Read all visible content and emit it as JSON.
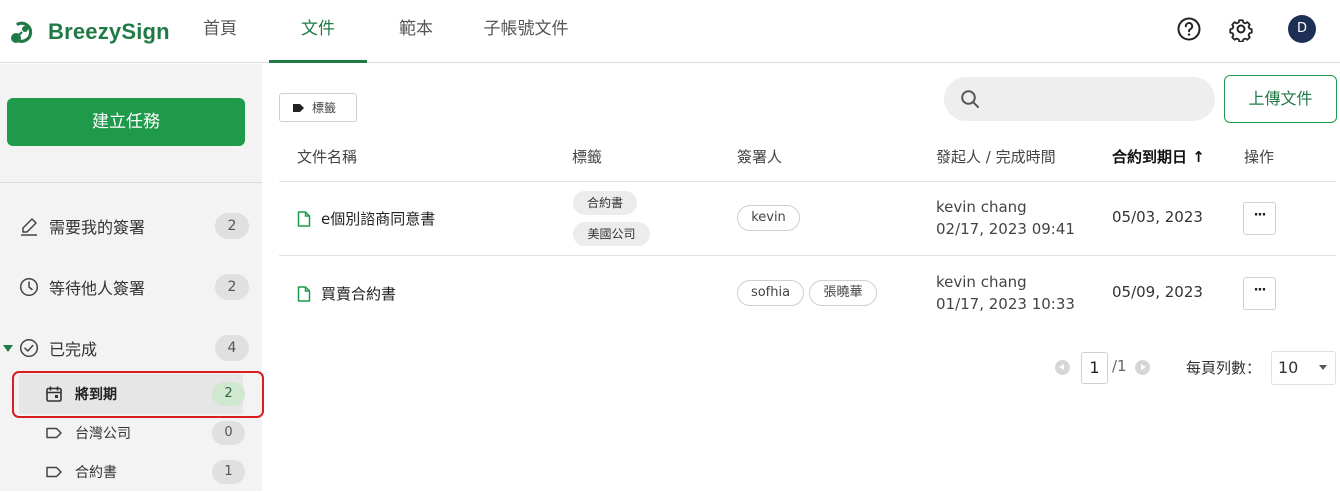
{
  "app": {
    "name": "BreezySign"
  },
  "nav": {
    "tabs": [
      {
        "label": "首頁"
      },
      {
        "label": "文件"
      },
      {
        "label": "範本"
      },
      {
        "label": "子帳號文件"
      }
    ],
    "active_tab": "文件",
    "avatar_initial": "D"
  },
  "sidebar": {
    "create_button": "建立任務",
    "items": [
      {
        "label": "需要我的簽署",
        "count": "2",
        "icon": "pencil-icon"
      },
      {
        "label": "等待他人簽署",
        "count": "2",
        "icon": "clock-icon"
      },
      {
        "label": "已完成",
        "count": "4",
        "icon": "check-circle-icon"
      }
    ],
    "sub_items": [
      {
        "label": "將到期",
        "count": "2",
        "icon": "calendar-icon"
      },
      {
        "label": "台灣公司",
        "count": "0",
        "icon": "tag-icon"
      },
      {
        "label": "合約書",
        "count": "1",
        "icon": "tag-icon"
      }
    ],
    "highlight_color": "#d81e1e"
  },
  "toolbar": {
    "tag_filter_label": "標籤",
    "search_placeholder": "",
    "upload_button": "上傳文件"
  },
  "table": {
    "headers": {
      "name": "文件名稱",
      "tags": "標籤",
      "signers": "簽署人",
      "sender": "發起人 / 完成時間",
      "expiry": "合約到期日",
      "actions": "操作"
    },
    "sort_indicator": "↑",
    "rows": [
      {
        "name": "e個別諮商同意書",
        "tags": [
          "合約書",
          "美國公司"
        ],
        "signers": [
          "kevin"
        ],
        "sender_name": "kevin chang",
        "sender_time": "02/17, 2023 09:41",
        "expiry": "05/03, 2023",
        "more": "···"
      },
      {
        "name": "買賣合約書",
        "tags": [],
        "signers": [
          "sofhia",
          "張曉華"
        ],
        "sender_name": "kevin chang",
        "sender_time": "01/17, 2023 10:33",
        "expiry": "05/09, 2023",
        "more": "···"
      }
    ]
  },
  "pagination": {
    "current_page": "1",
    "total_pages": "/1",
    "per_page_label": "每頁列數：",
    "per_page_value": "10"
  },
  "colors": {
    "brand": "#1f7a46",
    "primary_button": "#1f9a4a",
    "sidebar_bg": "#f3f3f3",
    "avatar": "#1e2f55"
  }
}
